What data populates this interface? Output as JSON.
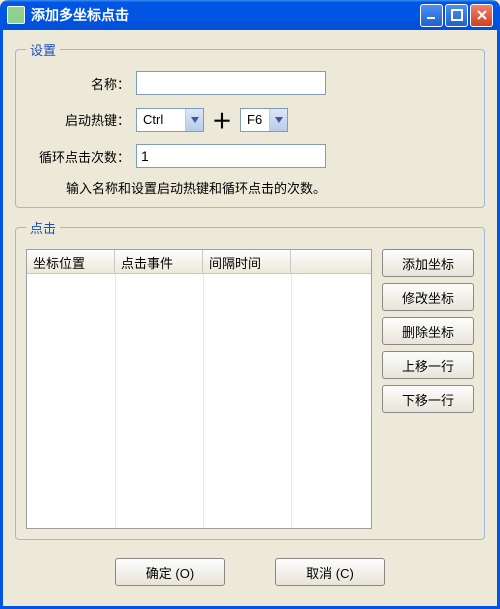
{
  "window": {
    "title": "添加多坐标点击"
  },
  "settings": {
    "legend": "设置",
    "name_label": "名称：",
    "name_value": "",
    "hotkey_label": "启动热键：",
    "hotkey_mod": "Ctrl",
    "plus": "＋",
    "hotkey_key": "F6",
    "loop_label": "循环点击次数：",
    "loop_value": "1",
    "hint": "输入名称和设置启动热键和循环点击的次数。"
  },
  "click": {
    "legend": "点击",
    "columns": [
      "坐标位置",
      "点击事件",
      "间隔时间"
    ],
    "buttons": {
      "add": "添加坐标",
      "edit": "修改坐标",
      "delete": "删除坐标",
      "moveup": "上移一行",
      "movedown": "下移一行"
    }
  },
  "footer": {
    "ok": "确定 (O)",
    "cancel": "取消 (C)"
  }
}
